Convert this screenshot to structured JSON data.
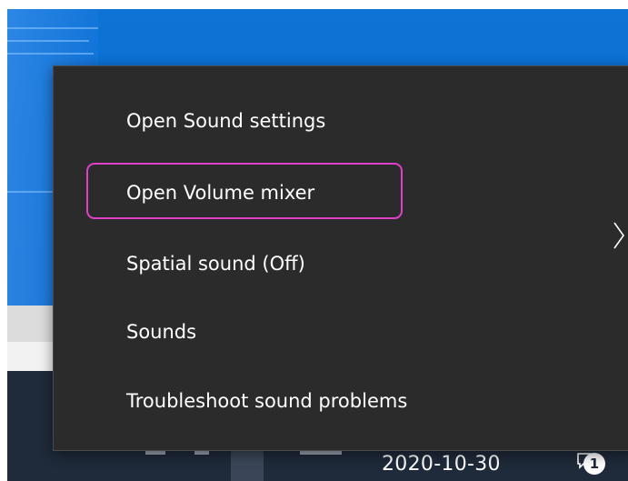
{
  "menu": {
    "items": [
      {
        "label": "Open Sound settings"
      },
      {
        "label": "Open Volume mixer"
      },
      {
        "label": "Spatial sound (Off)"
      },
      {
        "label": "Sounds"
      },
      {
        "label": "Troubleshoot sound problems"
      }
    ]
  },
  "taskbar": {
    "date": "2020-10-30",
    "notification_count": "1"
  },
  "colors": {
    "menu_bg": "#2b2b2b",
    "highlight": "#e040c8",
    "wallpaper": "#0a6dd0",
    "taskbar": "#1f2a3a"
  },
  "icons": {
    "submenu": "chevron-right-icon",
    "notifications": "notification-icon"
  }
}
